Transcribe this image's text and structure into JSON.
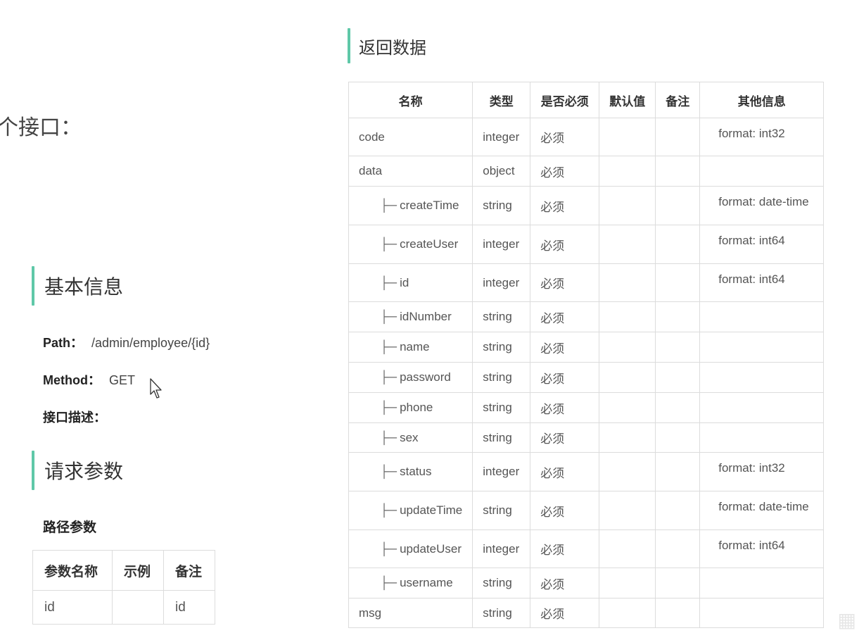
{
  "left": {
    "fragment_title": "个接口：",
    "basic_heading": "基本信息",
    "path_label": "Path：",
    "path_value": "/admin/employee/{id}",
    "method_label": "Method：",
    "method_value": "GET",
    "desc_label": "接口描述：",
    "request_heading": "请求参数",
    "path_params_title": "路径参数",
    "param_table": {
      "headers": [
        "参数名称",
        "示例",
        "备注"
      ],
      "rows": [
        [
          "id",
          "",
          "id"
        ]
      ]
    }
  },
  "right": {
    "return_heading": "返回数据",
    "headers": [
      "名称",
      "类型",
      "是否必须",
      "默认值",
      "备注",
      "其他信息"
    ],
    "tree_glyph": "├─",
    "rows": [
      {
        "name": "code",
        "type": "integer",
        "required": "必须",
        "default": "",
        "note": "",
        "info": "format: int32",
        "child": false
      },
      {
        "name": "data",
        "type": "object",
        "required": "必须",
        "default": "",
        "note": "",
        "info": "",
        "child": false
      },
      {
        "name": "createTime",
        "type": "string",
        "required": "必须",
        "default": "",
        "note": "",
        "info": "format: date-time",
        "child": true
      },
      {
        "name": "createUser",
        "type": "integer",
        "required": "必须",
        "default": "",
        "note": "",
        "info": "format: int64",
        "child": true
      },
      {
        "name": "id",
        "type": "integer",
        "required": "必须",
        "default": "",
        "note": "",
        "info": "format: int64",
        "child": true
      },
      {
        "name": "idNumber",
        "type": "string",
        "required": "必须",
        "default": "",
        "note": "",
        "info": "",
        "child": true
      },
      {
        "name": "name",
        "type": "string",
        "required": "必须",
        "default": "",
        "note": "",
        "info": "",
        "child": true
      },
      {
        "name": "password",
        "type": "string",
        "required": "必须",
        "default": "",
        "note": "",
        "info": "",
        "child": true
      },
      {
        "name": "phone",
        "type": "string",
        "required": "必须",
        "default": "",
        "note": "",
        "info": "",
        "child": true
      },
      {
        "name": "sex",
        "type": "string",
        "required": "必须",
        "default": "",
        "note": "",
        "info": "",
        "child": true
      },
      {
        "name": "status",
        "type": "integer",
        "required": "必须",
        "default": "",
        "note": "",
        "info": "format: int32",
        "child": true
      },
      {
        "name": "updateTime",
        "type": "string",
        "required": "必须",
        "default": "",
        "note": "",
        "info": "format: date-time",
        "child": true
      },
      {
        "name": "updateUser",
        "type": "integer",
        "required": "必须",
        "default": "",
        "note": "",
        "info": "format: int64",
        "child": true
      },
      {
        "name": "username",
        "type": "string",
        "required": "必须",
        "default": "",
        "note": "",
        "info": "",
        "child": true
      },
      {
        "name": "msg",
        "type": "string",
        "required": "必须",
        "default": "",
        "note": "",
        "info": "",
        "child": false
      }
    ]
  },
  "colors": {
    "accent_bar": "#5fc8a8",
    "border": "#dcdcdc",
    "text": "#333333"
  },
  "icons": {
    "cursor": "mouse-pointer-icon"
  }
}
